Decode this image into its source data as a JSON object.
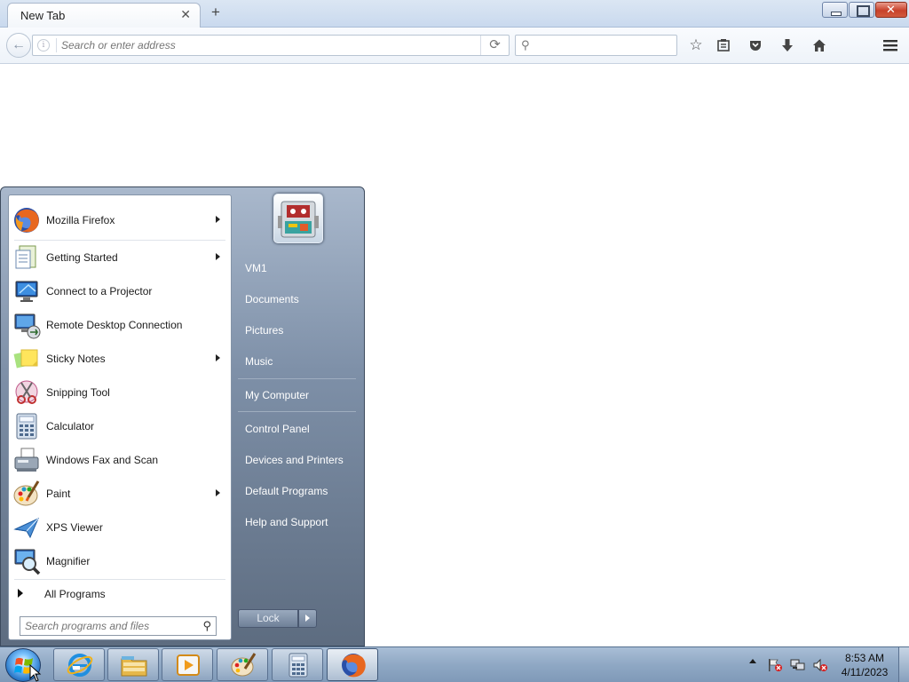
{
  "browser": {
    "tab_title": "New Tab",
    "url_placeholder": "Search or enter address",
    "search_placeholder": ""
  },
  "start_menu": {
    "programs": [
      {
        "label": "Mozilla Firefox",
        "icon": "firefox-icon",
        "has_submenu": true
      },
      {
        "label": "Getting Started",
        "icon": "getting-started-icon",
        "has_submenu": true
      },
      {
        "label": "Connect to a Projector",
        "icon": "projector-icon",
        "has_submenu": false
      },
      {
        "label": "Remote Desktop Connection",
        "icon": "remote-desktop-icon",
        "has_submenu": false
      },
      {
        "label": "Sticky Notes",
        "icon": "sticky-notes-icon",
        "has_submenu": true
      },
      {
        "label": "Snipping Tool",
        "icon": "snipping-tool-icon",
        "has_submenu": false
      },
      {
        "label": "Calculator",
        "icon": "calculator-icon",
        "has_submenu": false
      },
      {
        "label": "Windows Fax and Scan",
        "icon": "fax-icon",
        "has_submenu": false
      },
      {
        "label": "Paint",
        "icon": "paint-icon",
        "has_submenu": true
      },
      {
        "label": "XPS Viewer",
        "icon": "xps-viewer-icon",
        "has_submenu": false
      },
      {
        "label": "Magnifier",
        "icon": "magnifier-icon",
        "has_submenu": false
      }
    ],
    "all_programs_label": "All Programs",
    "search_placeholder": "Search programs and files",
    "right_links": {
      "user": "VM1",
      "documents": "Documents",
      "pictures": "Pictures",
      "music": "Music",
      "computer": "My Computer",
      "control_panel": "Control Panel",
      "devices": "Devices and Printers",
      "default_programs": "Default Programs",
      "help": "Help and Support"
    },
    "lock_label": "Lock"
  },
  "taskbar": {
    "pinned": [
      "internet-explorer-icon",
      "windows-explorer-icon",
      "media-player-icon",
      "paint-icon",
      "calculator-icon",
      "firefox-icon"
    ],
    "clock_time": "8:53 AM",
    "clock_date": "4/11/2023"
  }
}
